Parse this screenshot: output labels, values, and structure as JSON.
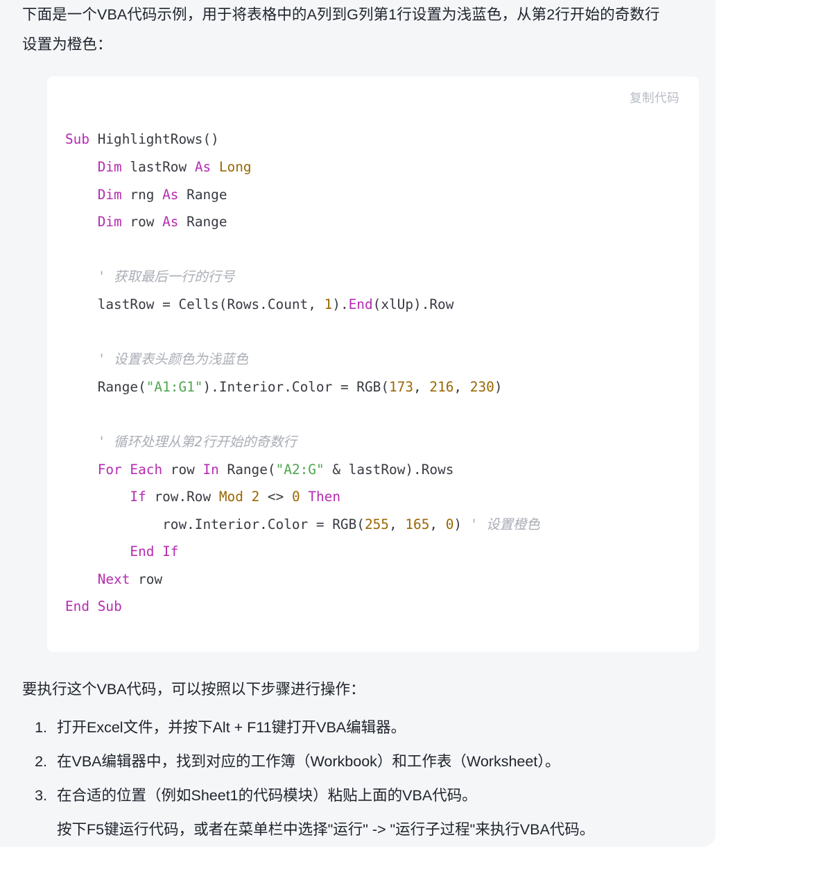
{
  "message": {
    "intro_paragraph": "下面是一个VBA代码示例，用于将表格中的A列到G列第1行设置为浅蓝色，从第2行开始的奇数行设置为橙色：",
    "steps_lead": "要执行这个VBA代码，可以按照以下步骤进行操作：",
    "steps": [
      "打开Excel文件，并按下Alt + F11键打开VBA编辑器。",
      "在VBA编辑器中，找到对应的工作簿（Workbook）和工作表（Worksheet）。",
      "在合适的位置（例如Sheet1的代码模块）粘贴上面的VBA代码。",
      "按下F5键运行代码，或者在菜单栏中选择\"运行\" -> \"运行子过程\"来执行VBA代码。"
    ]
  },
  "code_block": {
    "copy_label": "复制代码",
    "language": "vba",
    "plain_text": "Sub HighlightRows()\n    Dim lastRow As Long\n    Dim rng As Range\n    Dim row As Range\n\n    ' 获取最后一行的行号\n    lastRow = Cells(Rows.Count, 1).End(xlUp).Row\n\n    ' 设置表头颜色为浅蓝色\n    Range(\"A1:G1\").Interior.Color = RGB(173, 216, 230)\n\n    ' 循环处理从第2行开始的奇数行\n    For Each row In Range(\"A2:G\" & lastRow).Rows\n        If row.Row Mod 2 <> 0 Then\n            row.Interior.Color = RGB(255, 165, 0) ' 设置橙色\n        End If\n    Next row\nEnd Sub",
    "lines": [
      [
        {
          "t": "Sub",
          "c": "kw"
        },
        {
          "t": " HighlightRows()",
          "c": "pl"
        }
      ],
      [
        {
          "t": "    ",
          "c": "pl"
        },
        {
          "t": "Dim",
          "c": "kw"
        },
        {
          "t": " lastRow ",
          "c": "pl"
        },
        {
          "t": "As",
          "c": "kw"
        },
        {
          "t": " ",
          "c": "pl"
        },
        {
          "t": "Long",
          "c": "type"
        }
      ],
      [
        {
          "t": "    ",
          "c": "pl"
        },
        {
          "t": "Dim",
          "c": "kw"
        },
        {
          "t": " rng ",
          "c": "pl"
        },
        {
          "t": "As",
          "c": "kw"
        },
        {
          "t": " Range",
          "c": "pl"
        }
      ],
      [
        {
          "t": "    ",
          "c": "pl"
        },
        {
          "t": "Dim",
          "c": "kw"
        },
        {
          "t": " row ",
          "c": "pl"
        },
        {
          "t": "As",
          "c": "kw"
        },
        {
          "t": " Range",
          "c": "pl"
        }
      ],
      [],
      [
        {
          "t": "    ",
          "c": "pl"
        },
        {
          "t": "' 获取最后一行的行号",
          "c": "com"
        }
      ],
      [
        {
          "t": "    lastRow = Cells(Rows.Count, ",
          "c": "pl"
        },
        {
          "t": "1",
          "c": "num"
        },
        {
          "t": ").",
          "c": "pl"
        },
        {
          "t": "End",
          "c": "kw"
        },
        {
          "t": "(xlUp).Row",
          "c": "pl"
        }
      ],
      [],
      [
        {
          "t": "    ",
          "c": "pl"
        },
        {
          "t": "' 设置表头颜色为浅蓝色",
          "c": "com"
        }
      ],
      [
        {
          "t": "    Range(",
          "c": "pl"
        },
        {
          "t": "\"A1:G1\"",
          "c": "str"
        },
        {
          "t": ").Interior.Color = RGB(",
          "c": "pl"
        },
        {
          "t": "173",
          "c": "num"
        },
        {
          "t": ", ",
          "c": "pl"
        },
        {
          "t": "216",
          "c": "num"
        },
        {
          "t": ", ",
          "c": "pl"
        },
        {
          "t": "230",
          "c": "num"
        },
        {
          "t": ")",
          "c": "pl"
        }
      ],
      [],
      [
        {
          "t": "    ",
          "c": "pl"
        },
        {
          "t": "' 循环处理从第2行开始的奇数行",
          "c": "com"
        }
      ],
      [
        {
          "t": "    ",
          "c": "pl"
        },
        {
          "t": "For",
          "c": "kw"
        },
        {
          "t": " ",
          "c": "pl"
        },
        {
          "t": "Each",
          "c": "kw"
        },
        {
          "t": " row ",
          "c": "pl"
        },
        {
          "t": "In",
          "c": "kw"
        },
        {
          "t": " Range(",
          "c": "pl"
        },
        {
          "t": "\"A2:G\"",
          "c": "str"
        },
        {
          "t": " & lastRow).Rows",
          "c": "pl"
        }
      ],
      [
        {
          "t": "        ",
          "c": "pl"
        },
        {
          "t": "If",
          "c": "kw"
        },
        {
          "t": " row.Row ",
          "c": "pl"
        },
        {
          "t": "Mod",
          "c": "type"
        },
        {
          "t": " ",
          "c": "pl"
        },
        {
          "t": "2",
          "c": "num"
        },
        {
          "t": " <> ",
          "c": "pl"
        },
        {
          "t": "0",
          "c": "num"
        },
        {
          "t": " ",
          "c": "pl"
        },
        {
          "t": "Then",
          "c": "kw"
        }
      ],
      [
        {
          "t": "            row.Interior.Color = RGB(",
          "c": "pl"
        },
        {
          "t": "255",
          "c": "num"
        },
        {
          "t": ", ",
          "c": "pl"
        },
        {
          "t": "165",
          "c": "num"
        },
        {
          "t": ", ",
          "c": "pl"
        },
        {
          "t": "0",
          "c": "num"
        },
        {
          "t": ") ",
          "c": "pl"
        },
        {
          "t": "' 设置橙色",
          "c": "com"
        }
      ],
      [
        {
          "t": "        ",
          "c": "pl"
        },
        {
          "t": "End",
          "c": "kw"
        },
        {
          "t": " ",
          "c": "pl"
        },
        {
          "t": "If",
          "c": "kw"
        }
      ],
      [
        {
          "t": "    ",
          "c": "pl"
        },
        {
          "t": "Next",
          "c": "kw"
        },
        {
          "t": " row",
          "c": "pl"
        }
      ],
      [
        {
          "t": "End",
          "c": "kw"
        },
        {
          "t": " ",
          "c": "pl"
        },
        {
          "t": "Sub",
          "c": "kw"
        }
      ]
    ]
  },
  "colors": {
    "page_background": "#ffffff",
    "bubble_background": "#f4f6f8",
    "code_background": "#ffffff",
    "text": "#20242c",
    "code_text": "#383a42",
    "keyword": "#b52bb0",
    "type": "#9a6700",
    "number": "#9a6700",
    "string": "#4ca64c",
    "comment": "#a9adb5",
    "copy_label": "#b7bcc4"
  }
}
